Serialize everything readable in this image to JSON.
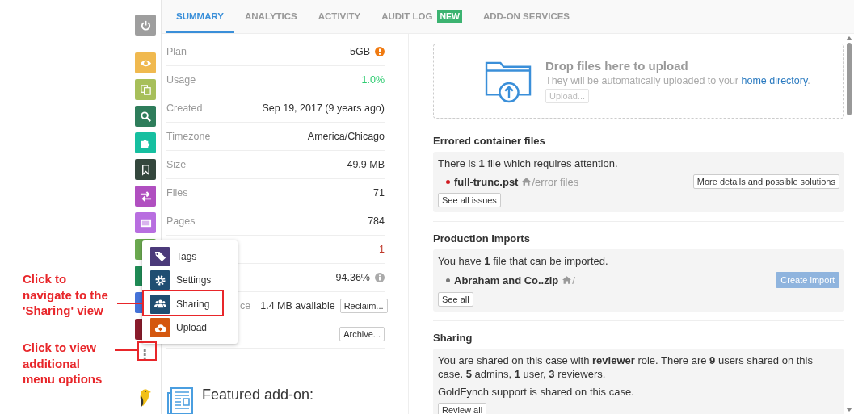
{
  "annotations": [
    {
      "text": "Click to navigate to the 'Sharing' view"
    },
    {
      "text": "Click to view additional menu options"
    }
  ],
  "sidebar": {
    "items": [
      {
        "kind": "power",
        "color": "#9e9e9e"
      },
      {
        "kind": "eye",
        "color": "#f0b94f"
      },
      {
        "kind": "copy",
        "color": "#a7bf5a"
      },
      {
        "kind": "search",
        "color": "#2e7d5b"
      },
      {
        "kind": "puzzle",
        "color": "#16bfa0"
      },
      {
        "kind": "bookmark",
        "color": "#34473d"
      },
      {
        "kind": "exchange",
        "color": "#b04fc0"
      },
      {
        "kind": "panel",
        "color": "#b86ee0"
      },
      {
        "kind": "plain",
        "color": "#6aa84f"
      },
      {
        "kind": "plain",
        "color": "#1f8a55"
      },
      {
        "kind": "plain",
        "color": "#4472d8"
      },
      {
        "kind": "plain",
        "color": "#8a1c2c"
      }
    ],
    "more": "⋮"
  },
  "menu": [
    {
      "label": "Tags",
      "kind": "tag",
      "color": "#4b3a7a"
    },
    {
      "label": "Settings",
      "kind": "gear",
      "color": "#1f4e72"
    },
    {
      "label": "Sharing",
      "kind": "users",
      "color": "#1f4e72"
    },
    {
      "label": "Upload",
      "kind": "upload",
      "color": "#d4570f"
    }
  ],
  "tabs": [
    {
      "label": "SUMMARY",
      "selected": true
    },
    {
      "label": "ANALYTICS",
      "selected": false
    },
    {
      "label": "ACTIVITY",
      "selected": false
    },
    {
      "label": "AUDIT LOG",
      "selected": false,
      "badge": "NEW"
    },
    {
      "label": "ADD-ON SERVICES",
      "selected": false
    }
  ],
  "summary": [
    {
      "label": "Plan",
      "value": "5GB",
      "kind": "alert"
    },
    {
      "label": "Usage",
      "value": "1.0%",
      "color": "#2ecc71"
    },
    {
      "label": "Created",
      "value": "Sep 19, 2017 (9 years ago)"
    },
    {
      "label": "Timezone",
      "value": "America/Chicago"
    },
    {
      "label": "Size",
      "value": "49.9 MB"
    },
    {
      "label": "Files",
      "value": "71"
    },
    {
      "label": "Pages",
      "value": "784"
    },
    {
      "value": "1",
      "color": "#c0392b"
    },
    {
      "value": "94.36%",
      "kind": "info"
    },
    {
      "label": "ce",
      "label_covered": true,
      "value": "1.4 MB available",
      "button": "Reclaim..."
    },
    {
      "button": "Archive..."
    }
  ],
  "featured": {
    "title": "Featured add-on:"
  },
  "upload": {
    "title": "Drop files here to upload",
    "text": "They will be automatically uploaded to your",
    "link": "home directory",
    "after": ".",
    "button": "Upload..."
  },
  "sections": [
    {
      "title": "Errored container files",
      "text": "There is **1** file which requires attention.",
      "items": [
        {
          "name": "full-trunc.pst",
          "path": "/error files",
          "color": "#d0191f",
          "button": "More details and possible solutions",
          "primary": false
        }
      ],
      "button": "See all issues"
    },
    {
      "title": "Production Imports",
      "text": "You have **1** file that can be imported.",
      "items": [
        {
          "name": "Abraham and Co..zip",
          "path": "/",
          "color": "#777777",
          "button": "Create import",
          "primary": true
        }
      ],
      "button": "See all"
    },
    {
      "title": "Sharing",
      "text": "You are shared on this case with **reviewer** role. There are **9** users shared on this case. **5** admins, **1** user, **3** reviewers.",
      "note": "GoldFynch support is shared on this case.",
      "button": "Review all"
    }
  ]
}
